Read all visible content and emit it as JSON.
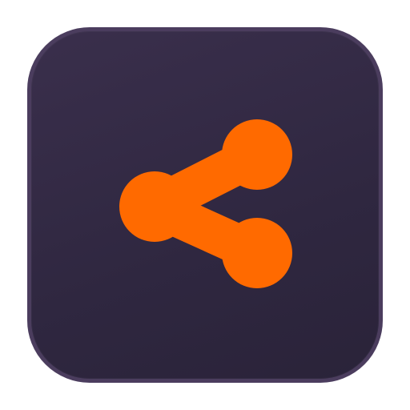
{
  "icon": {
    "name": "share-icon",
    "tile_color": "#322942",
    "border_color": "#4b3d5e",
    "glyph_color": "#ff6a00"
  }
}
